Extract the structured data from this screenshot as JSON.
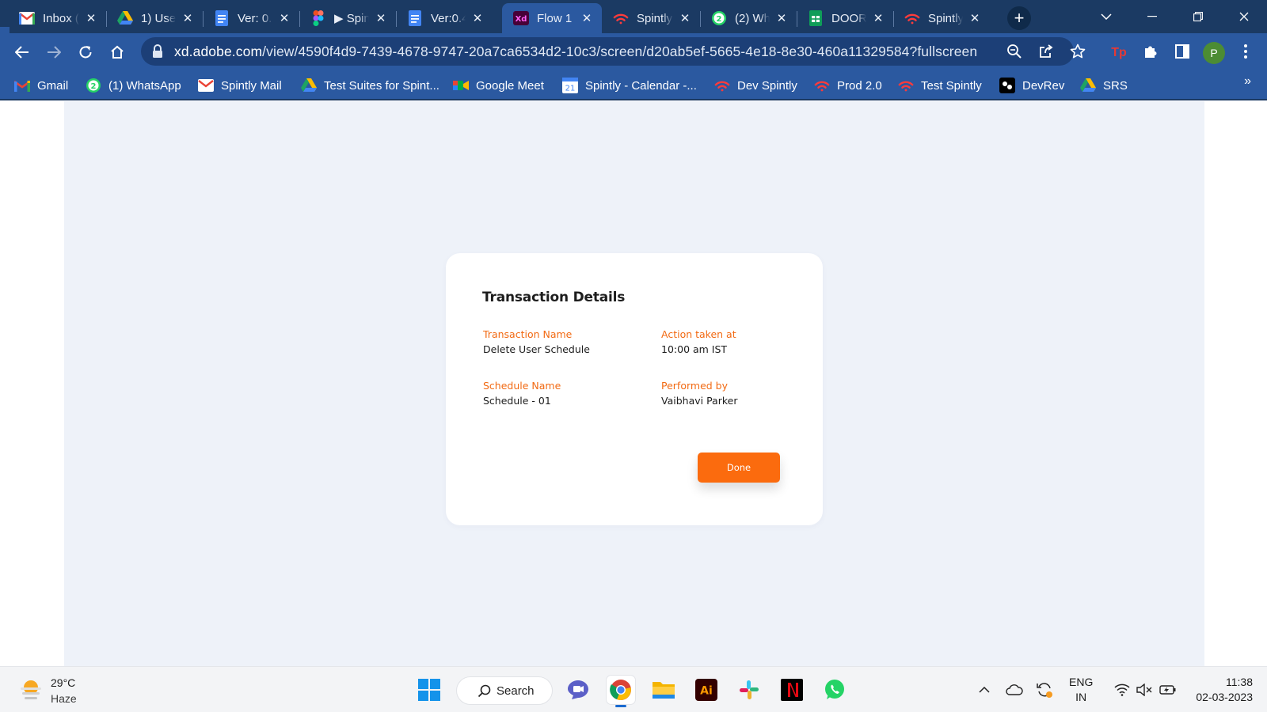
{
  "browser": {
    "tabs": [
      {
        "title": "Inbox (",
        "icon": "gmail-icon",
        "active": false
      },
      {
        "title": "1) User",
        "icon": "google-drive-icon",
        "active": false
      },
      {
        "title": "Ver: 0.",
        "icon": "google-docs-icon",
        "active": false
      },
      {
        "title": "▶ Spin",
        "icon": "figma-icon",
        "active": false
      },
      {
        "title": "Ver:0.4",
        "icon": "google-docs-icon",
        "active": false
      },
      {
        "title": "Flow 1",
        "icon": "adobe-xd-icon",
        "active": true
      },
      {
        "title": "Spintly",
        "icon": "spintly-icon",
        "active": false
      },
      {
        "title": "(2) Wh",
        "icon": "whatsapp-icon",
        "active": false
      },
      {
        "title": "DOOR",
        "icon": "google-sheets-icon",
        "active": false
      },
      {
        "title": "Spintly",
        "icon": "spintly-icon",
        "active": false
      }
    ],
    "url_host": "xd.adobe.com",
    "url_path": "/view/4590f4d9-7439-4678-9747-20a7ca6534d2-10c3/screen/d20ab5ef-5665-4e18-8e30-460a11329584?fullscreen",
    "profile_initial": "P",
    "bookmarks": [
      {
        "label": "Gmail",
        "icon": "gmail-icon"
      },
      {
        "label": "(1) WhatsApp",
        "icon": "whatsapp-icon"
      },
      {
        "label": "Spintly Mail",
        "icon": "gmail-icon"
      },
      {
        "label": "Test Suites for Spint...",
        "icon": "google-drive-icon"
      },
      {
        "label": "Google Meet",
        "icon": "google-meet-icon"
      },
      {
        "label": "Spintly - Calendar -...",
        "icon": "google-calendar-icon"
      },
      {
        "label": "Dev Spintly",
        "icon": "spintly-icon"
      },
      {
        "label": "Prod 2.0",
        "icon": "spintly-icon"
      },
      {
        "label": "Test Spintly",
        "icon": "spintly-icon"
      },
      {
        "label": "DevRev",
        "icon": "devrev-icon"
      },
      {
        "label": "SRS",
        "icon": "google-drive-icon"
      }
    ],
    "bookmarks_overflow": "»",
    "colors": {
      "frame": "#1b3a63",
      "toolbar": "#2b59a0"
    }
  },
  "dialog": {
    "title": "Transaction Details",
    "fields": [
      {
        "label": "Transaction Name",
        "value": "Delete User Schedule"
      },
      {
        "label": "Action taken at",
        "value": "10:00 am IST"
      },
      {
        "label": "Schedule Name",
        "value": "Schedule - 01"
      },
      {
        "label": "Performed by",
        "value": "Vaibhavi Parker"
      }
    ],
    "done_label": "Done",
    "colors": {
      "accent": "#fb6b0e",
      "label": "#f26a13",
      "backdrop": "#eef2f9"
    }
  },
  "taskbar": {
    "weather_temp": "29°C",
    "weather_desc": "Haze",
    "search_label": "Search",
    "lang_line1": "ENG",
    "lang_line2": "IN",
    "time": "11:38",
    "date": "02-03-2023"
  }
}
